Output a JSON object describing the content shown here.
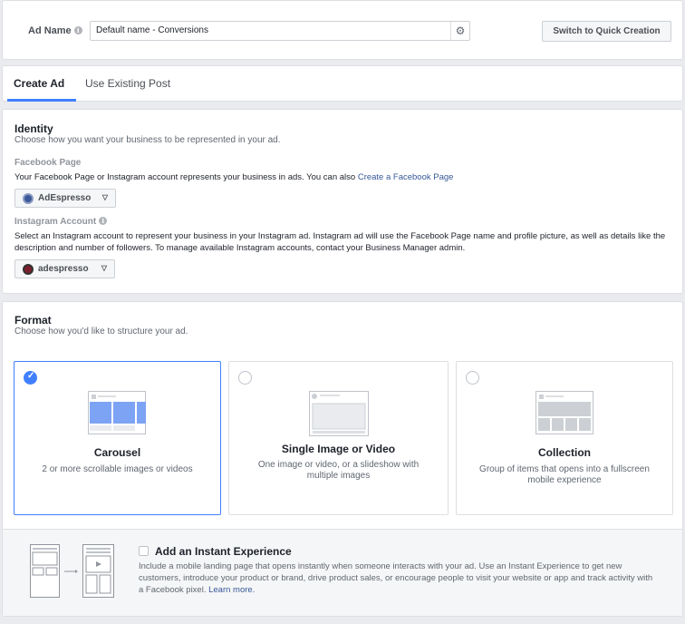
{
  "ad_name": {
    "label": "Ad Name",
    "info_icon": "i",
    "value": "Default name - Conversions",
    "gear_icon": "⚙",
    "quick_button": "Switch to Quick Creation"
  },
  "tabs": [
    {
      "label": "Create Ad",
      "active": true
    },
    {
      "label": "Use Existing Post",
      "active": false
    }
  ],
  "identity": {
    "title": "Identity",
    "subtitle": "Choose how you want your business to be represented in your ad.",
    "facebook_page": {
      "label": "Facebook Page",
      "description": "Your Facebook Page or Instagram account represents your business in ads. You can also ",
      "link": "Create a Facebook Page",
      "selected": "AdEspresso"
    },
    "instagram": {
      "label": "Instagram Account",
      "description": "Select an Instagram account to represent your business in your Instagram ad. Instagram ad will use the Facebook Page name and profile picture, as well as details like the description and number of followers. To manage available Instagram accounts, contact your Business Manager admin.",
      "selected": "adespresso"
    }
  },
  "format": {
    "title": "Format",
    "subtitle": "Choose how you'd like to structure your ad.",
    "options": [
      {
        "title": "Carousel",
        "description": "2 or more scrollable images or videos",
        "selected": true,
        "icon": "carousel-illustration"
      },
      {
        "title": "Single Image or Video",
        "description": "One image or video, or a slideshow with multiple images",
        "selected": false,
        "icon": "single-image-illustration"
      },
      {
        "title": "Collection",
        "description": "Group of items that opens into a fullscreen mobile experience",
        "selected": false,
        "icon": "collection-illustration"
      }
    ]
  },
  "instant_experience": {
    "title": "Add an Instant Experience",
    "description": "Include a mobile landing page that opens instantly when someone interacts with your ad. Use an Instant Experience to get new customers, introduce your product or brand, drive product sales, or encourage people to visit your website or app and track activity with a Facebook pixel. ",
    "link": "Learn more."
  },
  "colors": {
    "accent": "#4080ff",
    "link": "#365899",
    "background": "#e9ebee"
  }
}
